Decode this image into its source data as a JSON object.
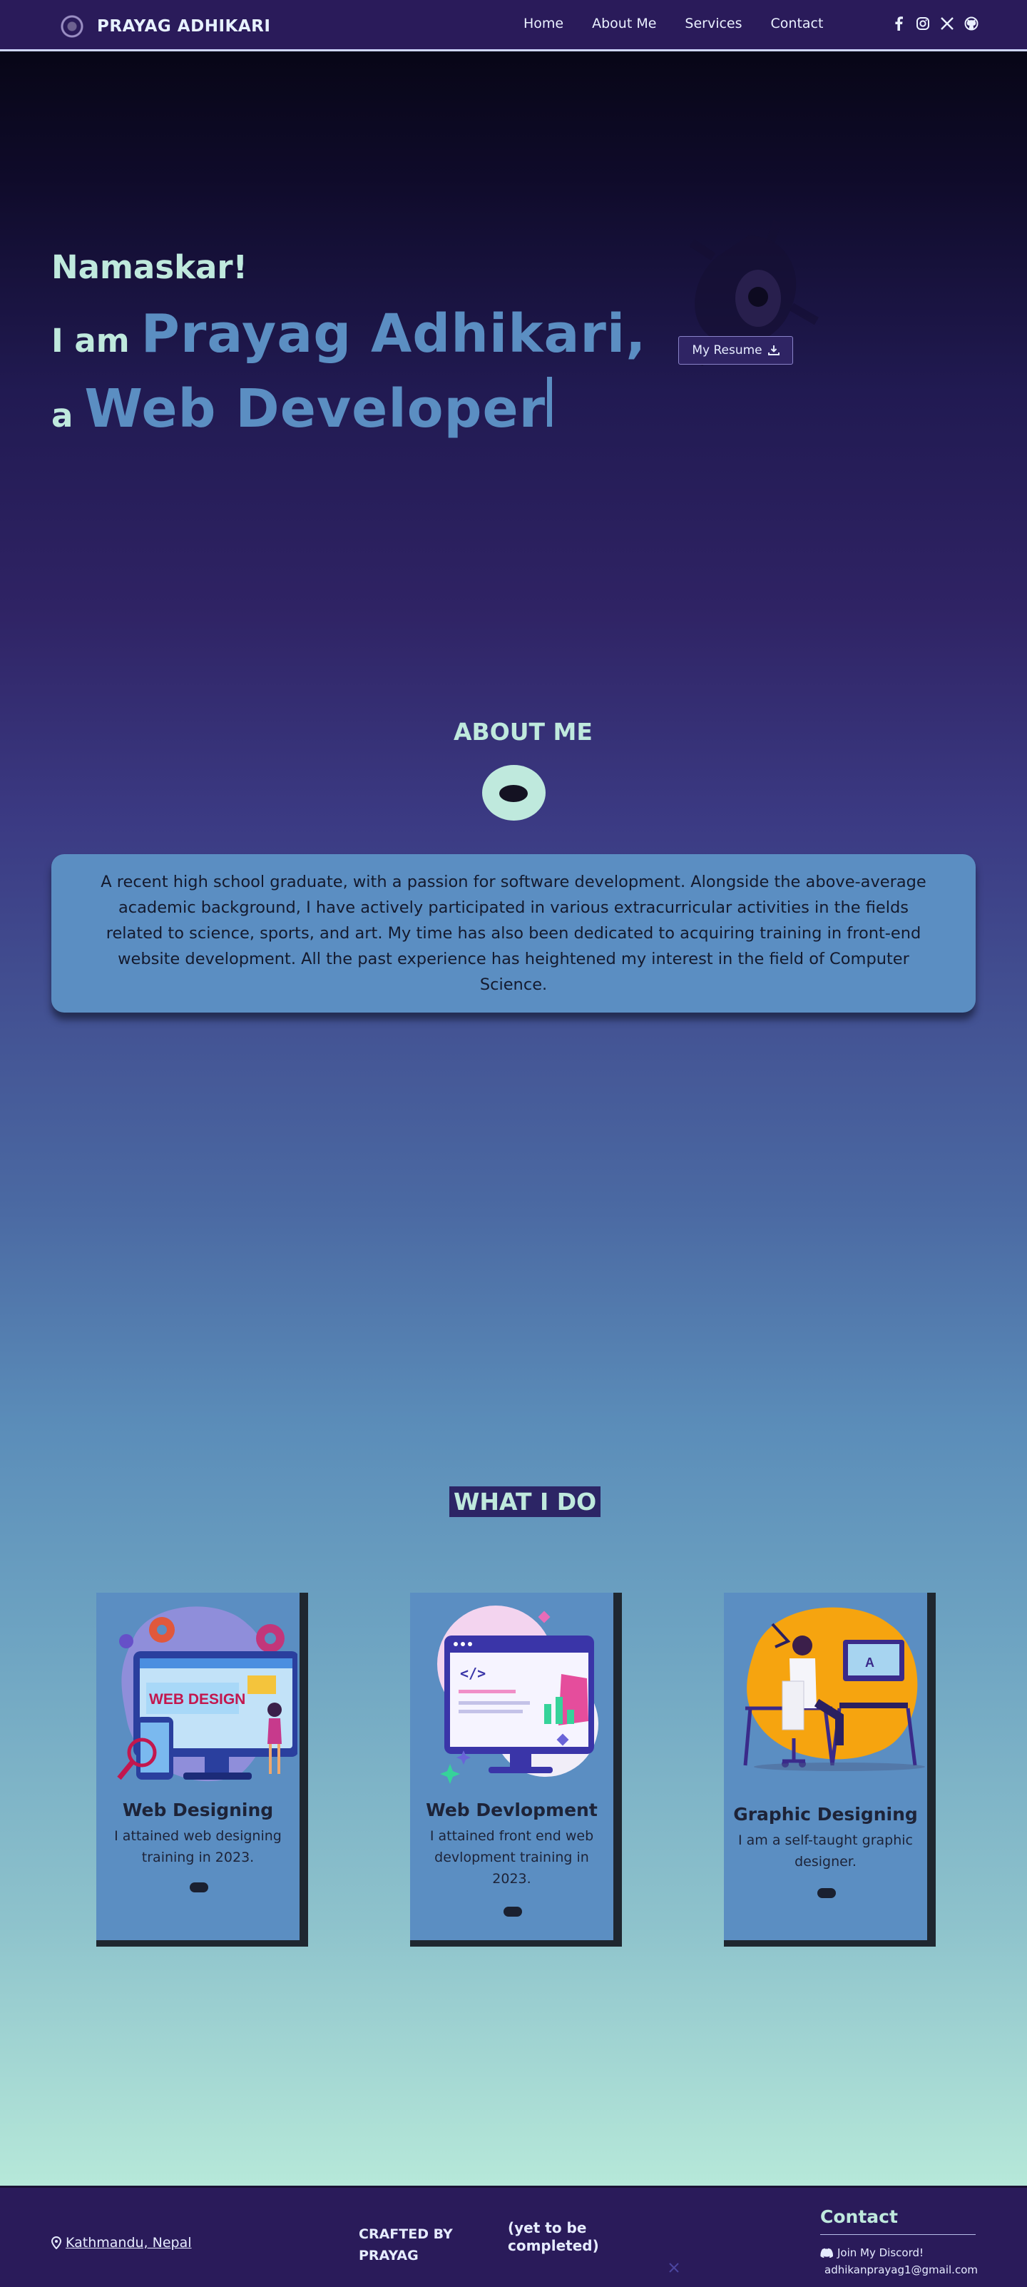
{
  "nav": {
    "brand": "PRAYAG ADHIKARI",
    "links": [
      "Home",
      "About Me",
      "Services",
      "Contact"
    ],
    "social_icons": [
      "facebook-icon",
      "instagram-icon",
      "x-icon",
      "github-icon"
    ]
  },
  "hero": {
    "greeting": "Namaskar!",
    "line1_prefix": "I am",
    "name": "Prayag Adhikari,",
    "line2_prefix": "a",
    "role": "Web Developer",
    "resume_label": "My Resume"
  },
  "about": {
    "title": "ABOUT ME",
    "text": "A recent high school graduate, with a passion for software development. Alongside the above-average academic background, I have actively participated in various extracurricular activities in the fields related to science, sports, and art. My time has also been dedicated to acquiring training in front-end website development. All the past experience has heightened my interest in the field of Computer Science."
  },
  "services": {
    "title": "WHAT I DO",
    "items": [
      {
        "title": "Web Designing",
        "desc": "I attained web designing training in 2023.",
        "image_text": "WEB DESIGN"
      },
      {
        "title": "Web Devlopment",
        "desc": "I attained front end web devlopment training in 2023."
      },
      {
        "title": "Graphic Designing",
        "desc": "I am a self-taught graphic designer."
      }
    ]
  },
  "footer": {
    "location": "Kathmandu, Nepal",
    "crafted": "CRAFTED BY PRAYAG",
    "note": "(yet to be completed)",
    "contact_title": "Contact",
    "discord": "Join My Discord!",
    "email": "adhikanprayag1@gmail.com"
  },
  "colors": {
    "nav_bg": "#2a1b5a",
    "accent_mint": "#bfe9dd",
    "accent_blue": "#5b8ec2"
  }
}
